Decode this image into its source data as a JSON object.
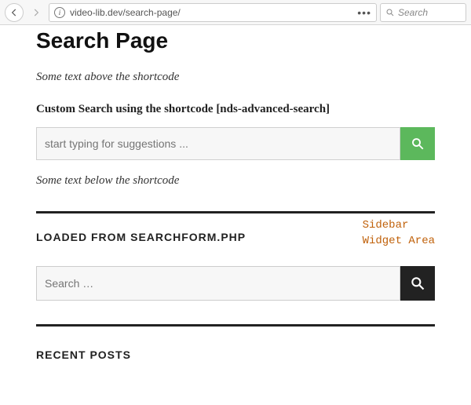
{
  "browser": {
    "url": "video-lib.dev/search-page/",
    "search_placeholder": "Search"
  },
  "page": {
    "title": "Search Page",
    "above_shortcode": "Some text above the shortcode",
    "custom_search_heading": "Custom Search using the shortcode [nds-advanced-search]",
    "custom_search_placeholder": "start typing for suggestions ...",
    "below_shortcode": "Some text below the shortcode"
  },
  "sidebar": {
    "searchform_heading": "LOADED FROM SEARCHFORM.PHP",
    "widget_area_label_l1": "Sidebar",
    "widget_area_label_l2": "Widget Area",
    "wp_search_placeholder": "Search …",
    "recent_posts_heading": "RECENT POSTS"
  }
}
